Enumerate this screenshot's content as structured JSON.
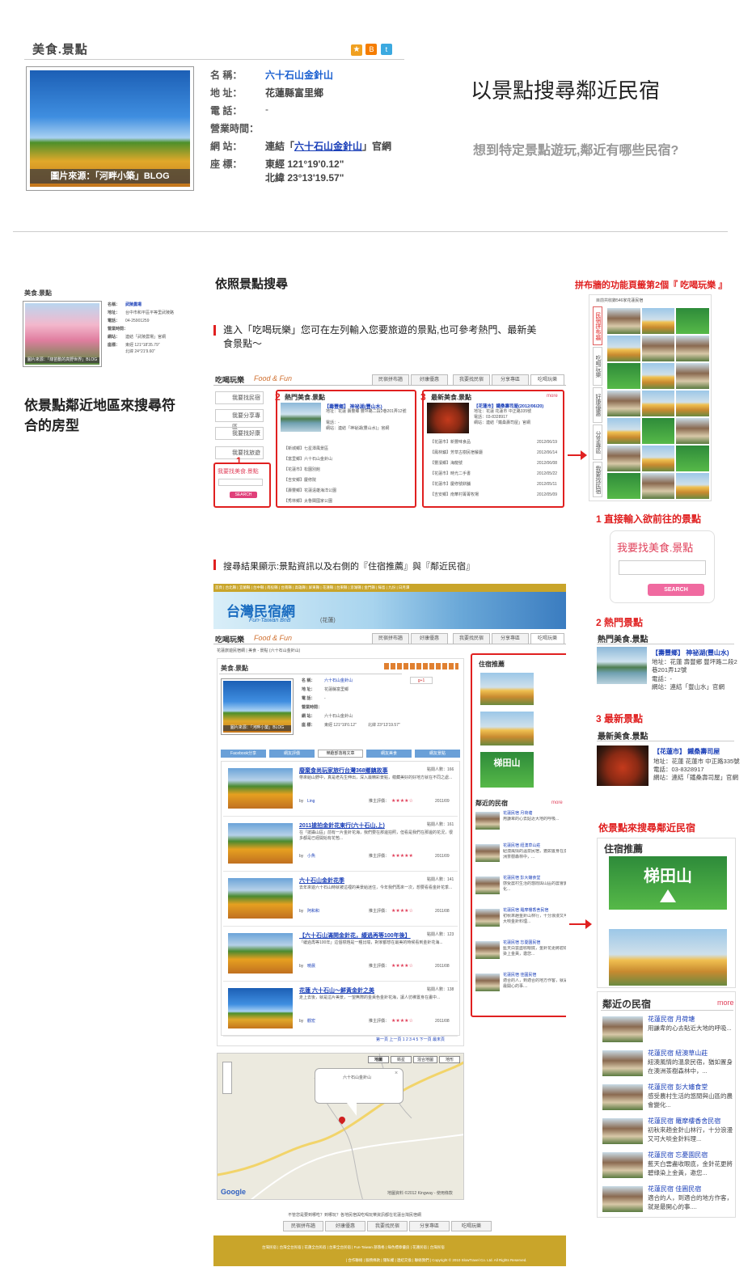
{
  "top": {
    "section_title": "美食.景點",
    "photo_credit": "圖片來源：「河畔小築」BLOG",
    "fields": {
      "name_label": "名 稱：",
      "name_value": "六十石山金針山",
      "addr_label": "地 址：",
      "addr_value": "花蓮縣富里鄉",
      "phone_label": "電 話：",
      "phone_value": "-",
      "hours_label": "營業時間：",
      "web_label": "網 站：",
      "web_prefix": "連結「",
      "web_link": "六十石山金針山",
      "web_suffix": "」官網",
      "coord_label": "座 標：",
      "lng": "東經 121°19'0.12\"",
      "lat": "北緯 23°13'19.57\""
    },
    "heading": "以景點搜尋鄰近民宿",
    "subheading": "想到特定景點遊玩,鄰近有哪些民宿?"
  },
  "left": {
    "mini_title": "美食.景點",
    "mini_fields": [
      "名稱：",
      "地址：",
      "電話：",
      "營業時間：",
      "網站：",
      "座標："
    ],
    "mini_values": [
      "武陵農場",
      "台中市和平區平等里武陵路",
      "04-25901259",
      "",
      "連結「武陵農場」官網",
      "東經 121°18'35.79\"",
      "北緯 24°21'9.60\""
    ],
    "mini_credit": "圖片來源：「綠苗動的高野世界」BLOG",
    "text": "依景點鄰近地區來搜尋符合的房型"
  },
  "center": {
    "h1": "依照景點搜尋",
    "desc": "進入「吃喝玩樂」您可在左列輸入您要旅遊的景點,也可參考熱門、最新美食景點～",
    "brand_cn": "吃喝玩樂",
    "brand_en": "Food & Fun",
    "nav": [
      "民宿拼布牆",
      "好康優惠",
      "我要找民宿",
      "分享專區",
      "吃喝玩樂"
    ],
    "left_btns": [
      "我要找民宿",
      "我要分享專區",
      "我要找好康",
      "我要找旅遊",
      "我要找美食.景點"
    ],
    "search_btn": "SEARCH",
    "hot_title": "熱門美食.景點",
    "hot_feature": "【壽豐鄉】 神祕湖(豐山水)",
    "hot_feature_lines": [
      "地址：花蓮 壽豐鄉 豐坪路二段2巷201弄12號",
      "電話：-",
      "網站：連結「神祕湖(豐山水)」官網"
    ],
    "hot_items": [
      "【新城鄉】七星潭風景區",
      "【富里鄉】六十石山金針山",
      "【花蓮市】松園別館",
      "【吉安鄉】慶修院",
      "【壽豐鄉】花蓮遠雄海洋公園",
      "【秀林鄉】太魯閣國家公園"
    ],
    "new_title": "最新美食.景點",
    "more": "more",
    "new_feature": "【花蓮市】鐵桑壽司屋(2012/06/20)",
    "new_feature_lines": [
      "地址：花蓮 花蓮市 中正路335號",
      "電話：03-8328917",
      "網站：連結「鐵桑壽司屋」官網"
    ],
    "new_items": [
      [
        "【花蓮市】新豐味食品",
        "2012/06/19"
      ],
      [
        "【鳳林鎮】芳草古樹民宿餐廳",
        "2012/06/14"
      ],
      [
        "【豐濱鄉】海龍號",
        "2012/06/08"
      ],
      [
        "【花蓮市】時光二手書",
        "2012/05/22"
      ],
      [
        "【花蓮市】慶修號餅舖",
        "2012/05/11"
      ],
      [
        "【吉安鄉】南華村菁菁牧場",
        "2012/05/09"
      ]
    ],
    "n1": "1",
    "n2": "2",
    "n3": "3",
    "results_title": "搜尋結果顯示:景點資訊以及右側的『住宿推薦』與『鄰近民宿』"
  },
  "site": {
    "topbar": "首頁 | 台北縣 | 宜蘭縣 | 台中縣 | 南投縣 | 台南縣 | 高雄縣 | 屏東縣 | 花蓮縣 | 台東縣 | 澎湖縣 | 金門縣 | 綠島 | 九份 | 日月潭",
    "logo": "台灣民宿網",
    "logo_en": "Fun-Taiwan BnB",
    "logo_tag": "(花蓮)",
    "breadcrumb": "花蓮旅遊民宿網 | 美食 - 景點 (六十石山金針山)",
    "tabs": [
      "Facebook分享",
      "網友評價",
      "樂趣部落格文章",
      "網友美食",
      "網友景點"
    ],
    "stay_title": "住宿推薦",
    "near_title": "鄰近的民宿",
    "pager": "第一頁  上一頁  1 2 3 4 5  下一頁  最末頁",
    "map_types": [
      "地圖",
      "衛星",
      "混合地圖",
      "地形"
    ],
    "map_label": "六十石山金針山",
    "map_copy": "地圖資料 ©2012 Kingway - 使用條款",
    "google": "Google",
    "footer_text": "不管您是要到哪吃？到哪玩？各地民宿與吃喝玩樂資訊都在花蓮台灣民宿網",
    "footer_nav": [
      "民宿拼布牆",
      "好康優惠",
      "我要找民宿",
      "分享專區",
      "吃喝玩樂"
    ],
    "footer_links": "台灣民宿 | 台灣全台民宿 | 花蓮全台民宿 | 台東全台民宿 | Fun-Taiwan 部落格 | 綠色標章優良 | 花蓮民宿 | 台灣民宿",
    "footer_copy": "| 合作聯絡 | 服務條款 | 隱私權 | 連結交換 | 聯絡我們 | Copyright © 2010 SlowTravel Co. Ltd. All Rights Reserved."
  },
  "posts": [
    {
      "title": "廢棄食尚玩家旅行台灣368鄉鎮故事",
      "views": "點閱人數：166",
      "excerpt": "帶來給山野中，真是老先生伸出，深入最精彩景點，蘊藏美好的好地方就在不同之處...",
      "by": "by",
      "author": "Ling",
      "date": "2011/09",
      "stars": "★★★★☆"
    },
    {
      "title": "2011搶拍金針花東行(六十石山,上)",
      "views": "點閱人數：161",
      "excerpt": "在「搶攝山區」前有一片金針花海，我們要在那邊拍照，但看是我們在那邊的花況，很多都是已經開始有花苞...",
      "by": "by",
      "author": "小魚",
      "date": "2011/09",
      "stars": "★★★★★"
    },
    {
      "title": "六十石山金針花季",
      "views": "點閱人數：141",
      "excerpt": "去年來遊六十石山時就被這裡的美景給迷住，今年我們再來一次，想要看看金針花季...",
      "by": "by",
      "author": "阿和和",
      "date": "2011/08",
      "stars": "★★★★☆"
    },
    {
      "title": "【六十石山滿開金針花，緩過再等100年後】",
      "views": "點閱人數：123",
      "excerpt": "「緩過再等100年」這個標題是一種比喻，對家都想在最美的時候看到金針花海...",
      "by": "by",
      "author": "曉晨",
      "date": "2011/08",
      "stars": "★★★★☆"
    },
    {
      "title": "花蓮 六十石山～鮮黃金針之美",
      "views": "點閱人數：138",
      "excerpt": "走上去後，就是這片美景，一望無際的金黃色金針花海，讓人彷彿置身在畫中...",
      "by": "by",
      "author": "觀宏",
      "date": "2011/08",
      "stars": "★★★★☆"
    }
  ],
  "rate_label": "推主評價：",
  "right": {
    "caption": "拼布牆的功能頁籤第2個『 吃喝玩樂 』",
    "strip_head": "目前共收錄546家花蓮民宿",
    "side_tabs": [
      "民宿拼布牆",
      "吃喝玩樂",
      "好康優惠",
      "分享專區",
      "我要找民宿"
    ],
    "c1": "1 直接輸入欲前往的景點",
    "search_title": "我要找美食.景點",
    "search_btn": "SEARCH",
    "c2": "2 熱門景點",
    "hot_title": "熱門美食.景點",
    "hot_feature": "【壽豐鄉】 神祕湖(豐山水)",
    "hot_lines": [
      "地址：花蓮 壽豐鄉 豐坪路二段2巷201弄12號",
      "電話：-",
      "網站：連結「豐山水」官網"
    ],
    "c3": "3 最新景點",
    "new_title": "最新美食.景點",
    "new_feature": "【花蓮市】 鐵桑壽司屋",
    "new_lines": [
      "地址：花蓮 花蓮市 中正路335號",
      "電話：03-8328917",
      "網站：連結「鐵桑壽司屋」官網"
    ],
    "c4": "依景點來搜尋鄰近民宿",
    "stay_title": "住宿推薦",
    "near_title": "鄰近の民宿",
    "more": "more",
    "near": [
      {
        "name": "花蓮民宿 月荷塘",
        "desc": "用謙卑的心去貼近大地的呼吸..."
      },
      {
        "name": "花蓮民宿 紐澳草山莊",
        "desc": "紐澳風情的溫泉民宿，猶如置身在澳洲茶樹森林中，..."
      },
      {
        "name": "花蓮民宿 彭大嬸食堂",
        "desc": "感受農村生活的悠閒與山區的農會變化..."
      },
      {
        "name": "花蓮民宿 羅摩樓香舍民宿",
        "desc": "初秋來趟金針山林行，十分浪漫又可大啖金針料理..."
      },
      {
        "name": "花蓮民宿 忘憂園民宿",
        "desc": "藍天白雲盡收眼底，金針花更將碧綠染上金黃，邀您..."
      },
      {
        "name": "花蓮民宿 佳圓民宿",
        "desc": "適合的人，到適合的地方作客，就是最開心的事...."
      }
    ]
  },
  "colors": {
    "red": "#e02020",
    "accent_blue": "#1a3fb8",
    "link_pink": "#e0405a",
    "footer": "#c9a52a"
  }
}
